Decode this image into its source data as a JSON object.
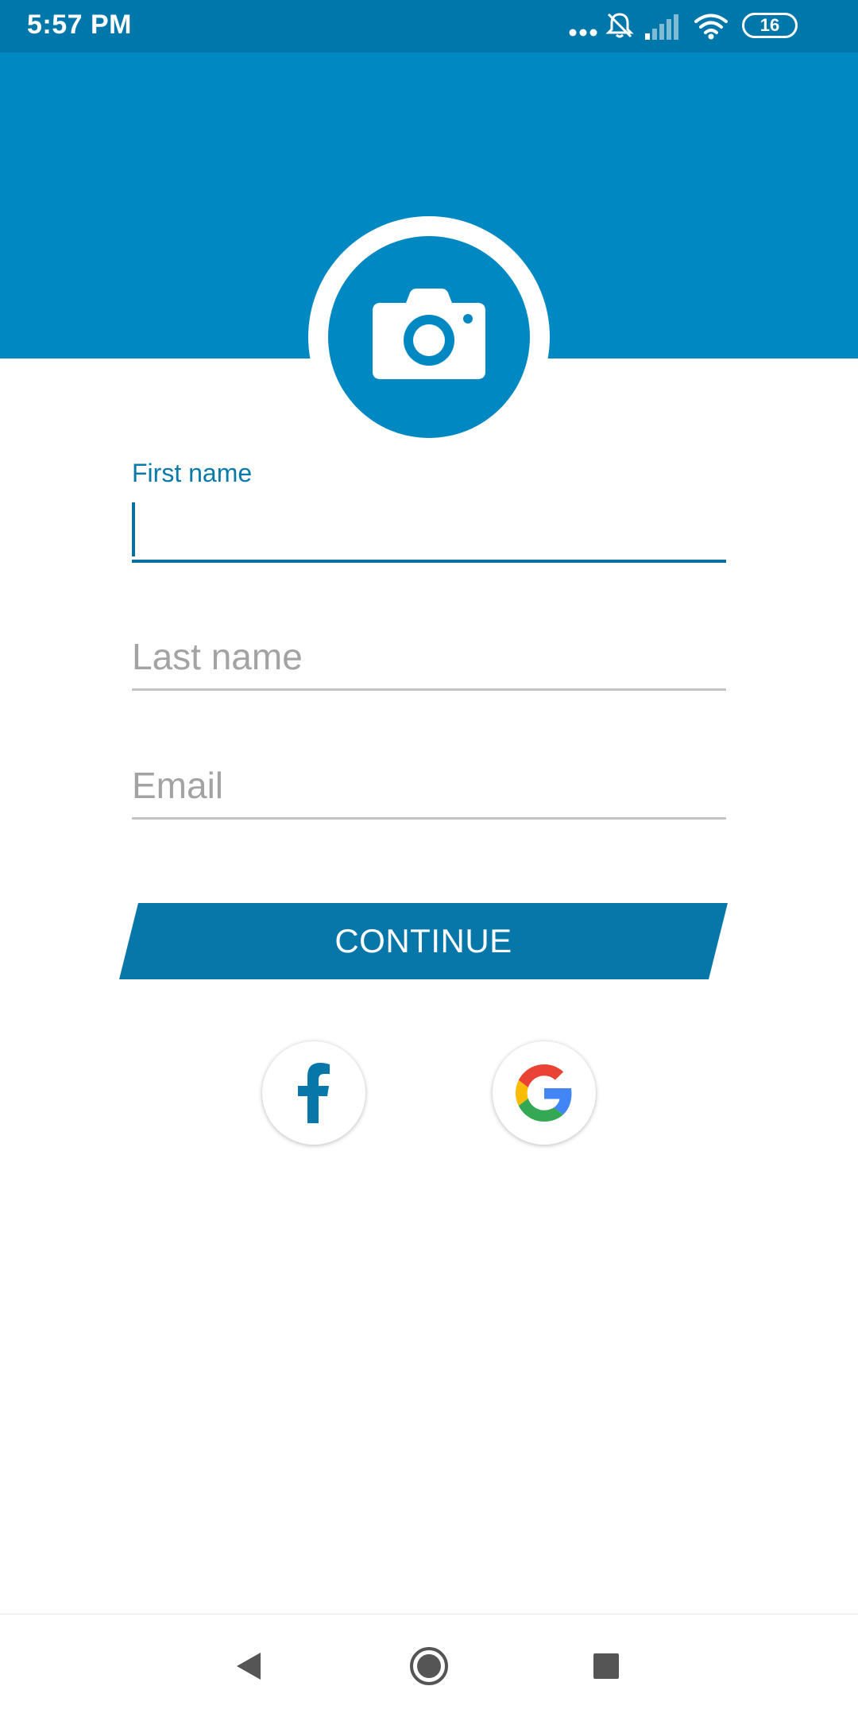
{
  "status_bar": {
    "time": "5:57 PM",
    "battery": "16",
    "icons": [
      "more-dots-icon",
      "bell-off-icon",
      "signal-icon",
      "wifi-icon",
      "battery-icon"
    ]
  },
  "theme": {
    "primary": "#0088c2",
    "status_bar": "#0077aa",
    "button": "#0777a9",
    "label": "#0a7aa8",
    "placeholder": "#a3a3a3"
  },
  "avatar": {
    "icon": "camera-icon"
  },
  "form": {
    "first_name": {
      "label": "First name",
      "value": "",
      "placeholder": ""
    },
    "last_name": {
      "placeholder": "Last name",
      "value": ""
    },
    "email": {
      "placeholder": "Email",
      "value": ""
    }
  },
  "continue_label": "CONTINUE",
  "social": [
    {
      "icon": "facebook-icon"
    },
    {
      "icon": "google-icon"
    }
  ],
  "nav": [
    "back-icon",
    "home-icon",
    "recents-icon"
  ]
}
